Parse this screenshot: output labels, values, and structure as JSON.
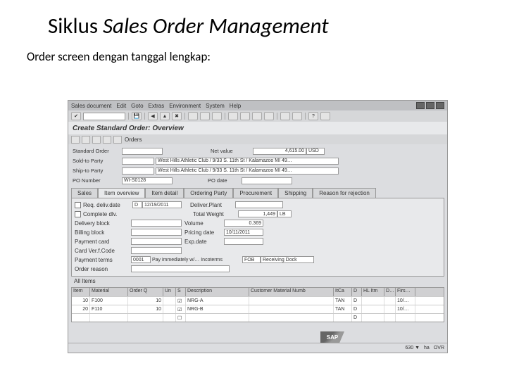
{
  "slide": {
    "title_plain": "Siklus ",
    "title_ital": "Sales Order Management",
    "subtitle": "Order screen dengan tanggal lengkap:"
  },
  "menubar": [
    "Sales document",
    "Edit",
    "Goto",
    "Extras",
    "Environment",
    "System",
    "Help"
  ],
  "header": "Create Standard Order: Overview",
  "toolbar2_last": "Orders",
  "form": {
    "standard_order_label": "Standard Order",
    "net_value_label": "Net value",
    "net_value_amount": "4,615.00",
    "net_value_curr": "USD",
    "sold_to_label": "Sold-to Party",
    "sold_to_text": "West Hills Athletic Club / 9/33 S. 11th St / Kalamazoo MI 49…",
    "ship_to_label": "Ship-to Party",
    "ship_to_text": "West Hills Athletic Club / 9/33 S. 11th St / Kalamazoo MI 49…",
    "po_number_label": "PO Number",
    "po_number_value": "WI-S0128",
    "po_date_label": "PO date"
  },
  "tabs": [
    "Sales",
    "Item overview",
    "Item detail",
    "Ordering Party",
    "Procurement",
    "Shipping",
    "Reason for rejection"
  ],
  "active_tab": 1,
  "details": {
    "req_deliv_date_label": "Req. deliv.date",
    "req_deliv_date_code": "D",
    "req_deliv_date_val": "12/19/2011",
    "deliver_plant_label": "Deliver.Plant",
    "complete_dlv_label": "Complete dlv.",
    "total_weight_label": "Total Weight",
    "total_weight_val": "1,449",
    "total_weight_unit": "LB",
    "delivery_block_label": "Delivery block",
    "volume_label": "Volume",
    "volume_val": "0.369",
    "billing_block_label": "Billing block",
    "pricing_date_label": "Pricing date",
    "pricing_date_val": "10/11/2011",
    "payment_card_label": "Payment card",
    "exp_date_label": "Exp.date",
    "card_verif_label": "Card Ver.f.Code",
    "payment_terms_label": "Payment terms",
    "payment_terms_val": "0001",
    "payment_terms_txt": "Pay immediately w/… Incoterms",
    "incoterms_val": "FOB",
    "incoterms_txt": "Receiving Dock",
    "order_reason_label": "Order reason"
  },
  "items_label": "All Items",
  "table": {
    "cols": [
      "Item",
      "Material",
      "Order Q",
      "Un",
      "S",
      "Description",
      "Customer Material Numb",
      "ItCa",
      "D",
      "HL Itm",
      "D…",
      "Firs…"
    ],
    "rows": [
      {
        "item": "10",
        "material": "F100",
        "qty": "10",
        "un": "",
        "s": "☑",
        "desc": "NRG-A",
        "cust": "",
        "itca": "TAN",
        "d": "D",
        "hl": "",
        "d2": "",
        "firs": "10/…"
      },
      {
        "item": "20",
        "material": "F110",
        "qty": "10",
        "un": "",
        "s": "☑",
        "desc": "NRG-B",
        "cust": "",
        "itca": "TAN",
        "d": "D",
        "hl": "",
        "d2": "",
        "firs": "10/…"
      },
      {
        "item": "",
        "material": "",
        "qty": "",
        "un": "",
        "s": "☐",
        "desc": "",
        "cust": "",
        "itca": "",
        "d": "D",
        "hl": "",
        "d2": "",
        "firs": ""
      }
    ]
  },
  "statusbar": {
    "left": "",
    "right": [
      "630 ▼",
      "ha",
      "OVR"
    ]
  },
  "sap": "SAP"
}
